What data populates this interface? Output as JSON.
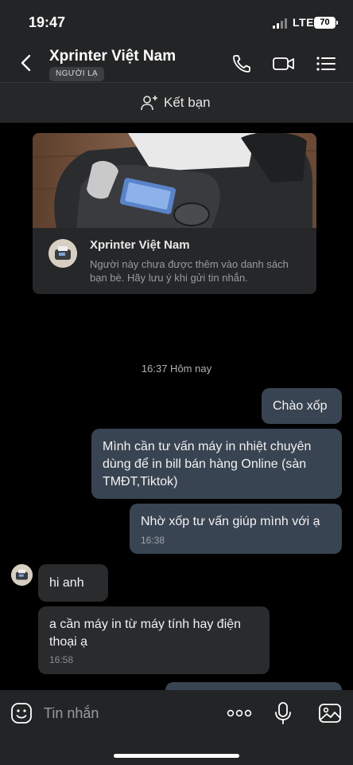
{
  "status_bar": {
    "time": "19:47",
    "network": "LTE",
    "battery": "70"
  },
  "header": {
    "title": "Xprinter Việt Nam",
    "badge": "NGƯỜI LẠ"
  },
  "friend_bar": {
    "label": "Kết bạn"
  },
  "profile_card": {
    "name": "Xprinter Việt Nam",
    "note": "Người này chưa được thêm vào danh sách bạn bè. Hãy lưu ý khi gửi tin nhắn."
  },
  "chat": {
    "separator": "16:37 Hôm nay",
    "messages": [
      {
        "direction": "out",
        "text": "Chào xốp"
      },
      {
        "direction": "out",
        "text": "Mình cần tư vấn máy in nhiệt chuyên dùng để in bill bán hàng Online (sàn TMĐT,Tiktok)"
      },
      {
        "direction": "out",
        "text": "Nhờ xốp tư vấn giúp mình với ạ",
        "time": "16:38"
      },
      {
        "direction": "in",
        "text": "hi anh"
      },
      {
        "direction": "in",
        "text": "a cần máy in từ máy tính hay điện thoại ạ",
        "time": "16:58"
      }
    ]
  },
  "input_bar": {
    "placeholder": "Tin nhắn"
  },
  "colors": {
    "header_bg": "#232425",
    "outgoing_bubble": "#394452",
    "incoming_bubble": "#2a2b2d",
    "background": "#000000"
  }
}
